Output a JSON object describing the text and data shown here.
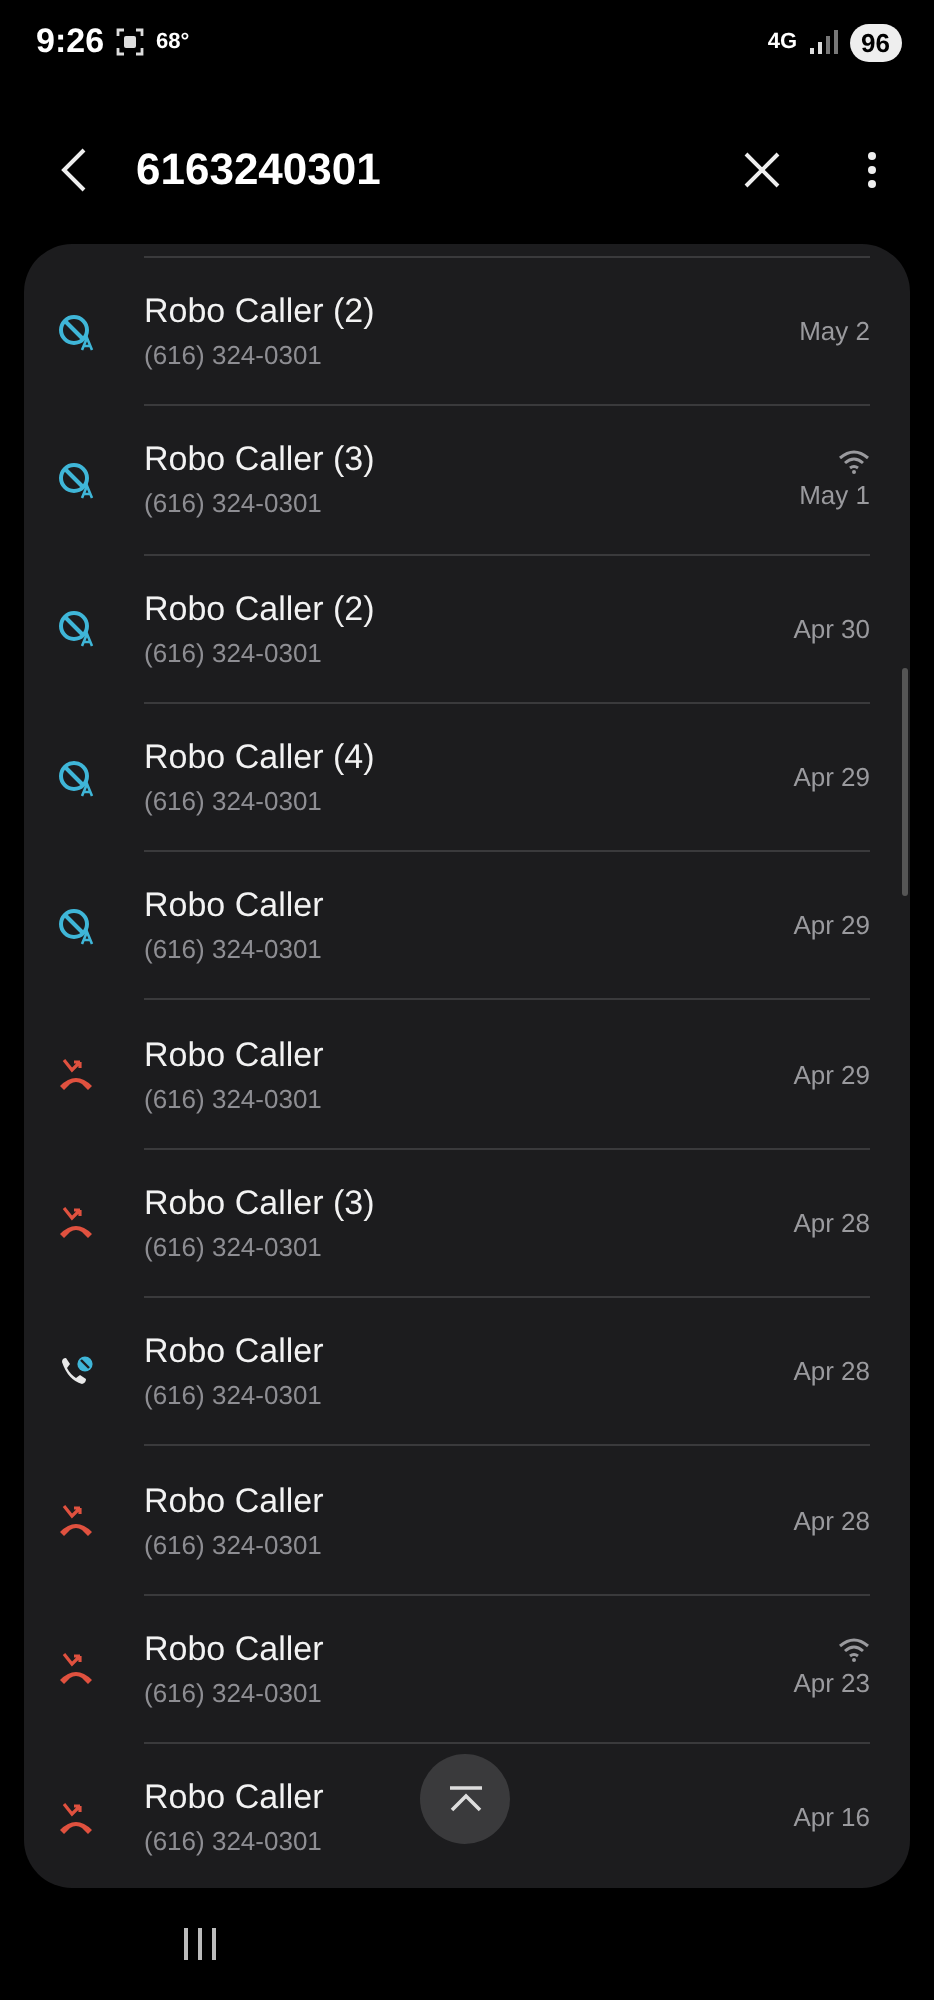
{
  "status_bar": {
    "time": "9:26",
    "temperature": "68°",
    "network": "4G",
    "battery": "96"
  },
  "header": {
    "query": "6163240301"
  },
  "calls": [
    {
      "kind": "blocked",
      "name": "Robo Caller (2)",
      "number": "(616) 324-0301",
      "date": "May 2",
      "wifi": false
    },
    {
      "kind": "blocked",
      "name": "Robo Caller (3)",
      "number": "(616) 324-0301",
      "date": "May 1",
      "wifi": true
    },
    {
      "kind": "blocked",
      "name": "Robo Caller (2)",
      "number": "(616) 324-0301",
      "date": "Apr 30",
      "wifi": false
    },
    {
      "kind": "blocked",
      "name": "Robo Caller (4)",
      "number": "(616) 324-0301",
      "date": "Apr 29",
      "wifi": false
    },
    {
      "kind": "blocked",
      "name": "Robo Caller",
      "number": "(616) 324-0301",
      "date": "Apr 29",
      "wifi": false
    },
    {
      "kind": "rejected",
      "name": "Robo Caller",
      "number": "(616) 324-0301",
      "date": "Apr 29",
      "wifi": false
    },
    {
      "kind": "rejected",
      "name": "Robo Caller (3)",
      "number": "(616) 324-0301",
      "date": "Apr 28",
      "wifi": false
    },
    {
      "kind": "screened",
      "name": "Robo Caller",
      "number": "(616) 324-0301",
      "date": "Apr 28",
      "wifi": false
    },
    {
      "kind": "rejected",
      "name": "Robo Caller",
      "number": "(616) 324-0301",
      "date": "Apr 28",
      "wifi": false
    },
    {
      "kind": "rejected",
      "name": "Robo Caller",
      "number": "(616) 324-0301",
      "date": "Apr 23",
      "wifi": true
    },
    {
      "kind": "rejected",
      "name": "Robo Caller",
      "number": "(616) 324-0301",
      "date": "Apr 16",
      "wifi": false
    }
  ]
}
